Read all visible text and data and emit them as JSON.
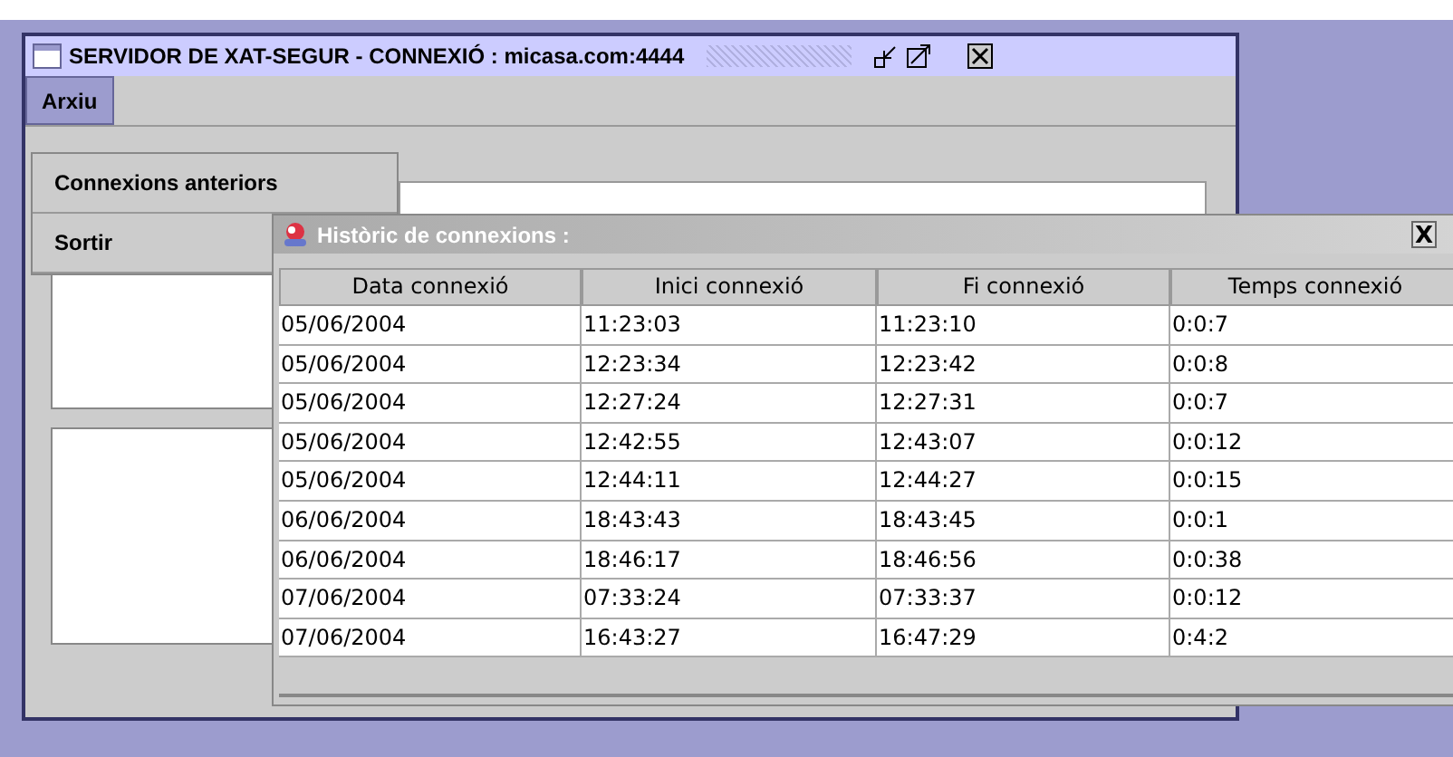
{
  "main_window": {
    "title": "SERVIDOR DE XAT-SEGUR - CONNEXIÓ : micasa.com:4444"
  },
  "menu_bar": [
    {
      "label": "Arxiu",
      "selected": true
    }
  ],
  "menu": [
    {
      "label": "Connexions anteriors"
    },
    {
      "label": "Sortir"
    }
  ],
  "dialog": {
    "title": "Històric de connexions :",
    "close": "X",
    "table": {
      "columns": [
        "Data connexió",
        "Inici connexió",
        "Fi connexió",
        "Temps connexió"
      ],
      "rows": [
        [
          "05/06/2004",
          "11:23:03",
          "11:23:10",
          "0:0:7"
        ],
        [
          "05/06/2004",
          "12:23:34",
          "12:23:42",
          "0:0:8"
        ],
        [
          "05/06/2004",
          "12:27:24",
          "12:27:31",
          "0:0:7"
        ],
        [
          "05/06/2004",
          "12:42:55",
          "12:43:07",
          "0:0:12"
        ],
        [
          "05/06/2004",
          "12:44:11",
          "12:44:27",
          "0:0:15"
        ],
        [
          "06/06/2004",
          "18:43:43",
          "18:43:45",
          "0:0:1"
        ],
        [
          "06/06/2004",
          "18:46:17",
          "18:46:56",
          "0:0:38"
        ],
        [
          "07/06/2004",
          "07:33:24",
          "07:33:37",
          "0:0:12"
        ],
        [
          "07/06/2004",
          "16:43:27",
          "16:47:29",
          "0:4:2"
        ]
      ]
    }
  }
}
